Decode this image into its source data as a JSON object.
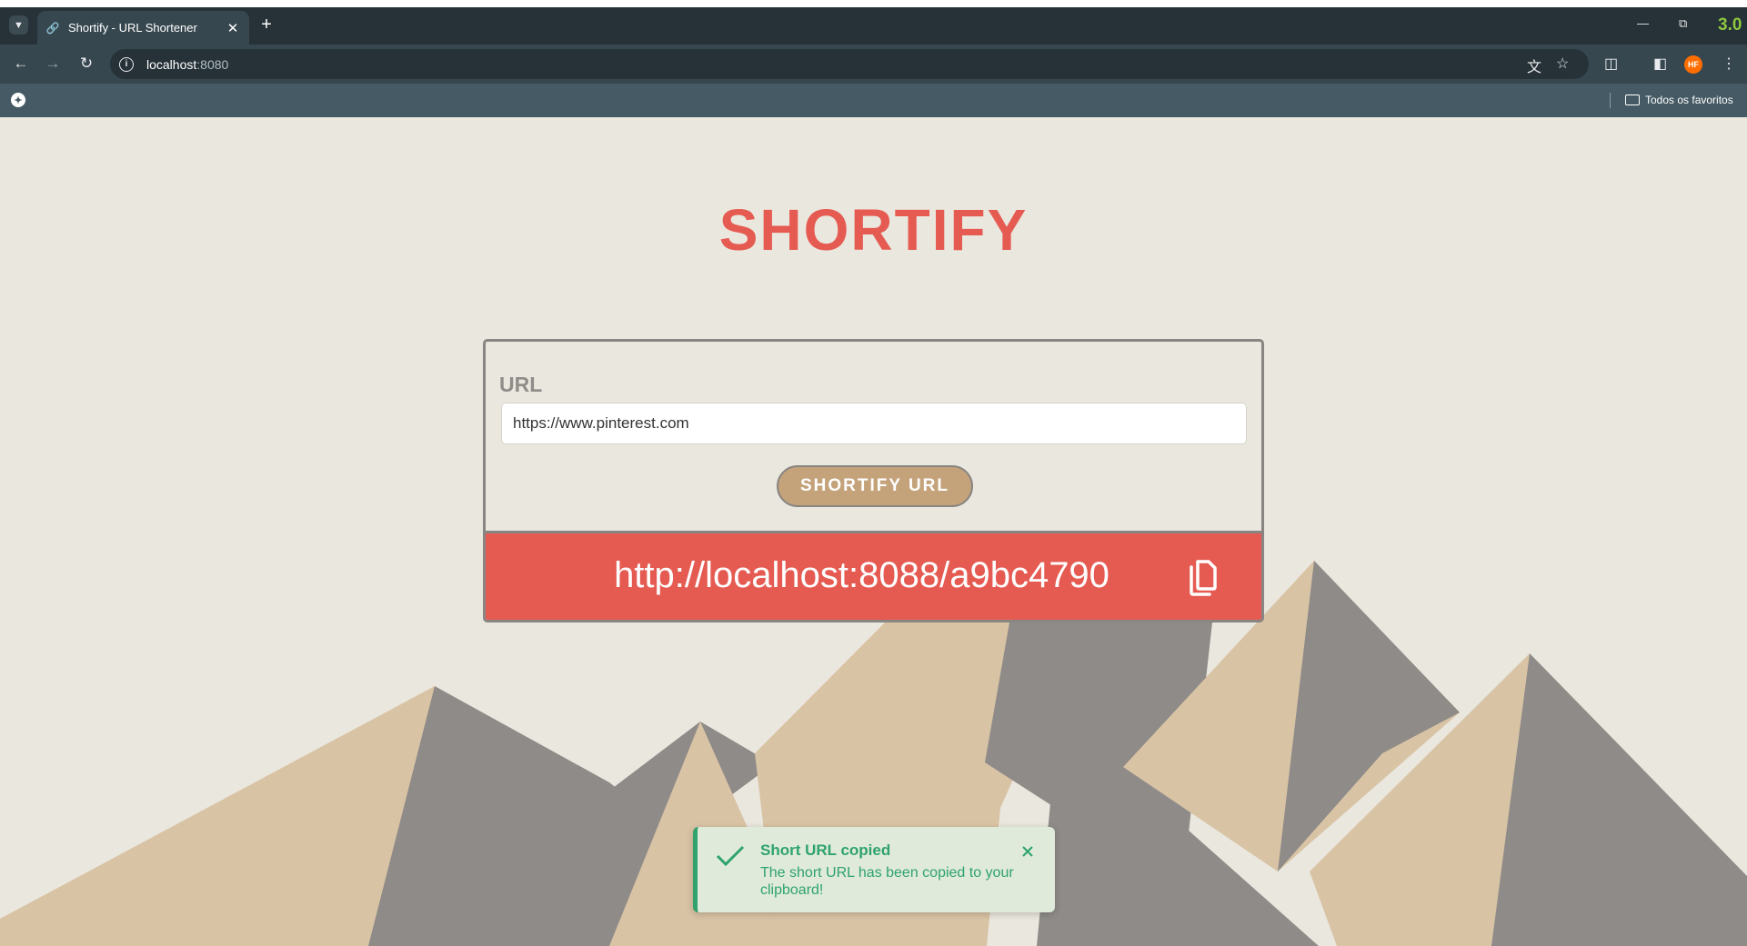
{
  "browser": {
    "tab_title": "Shortify - URL Shortener",
    "tab_close": "✕",
    "new_tab": "+",
    "url_host": "localhost",
    "url_port": ":8080",
    "bookmarks_folder": "Todos os favoritos",
    "profile_initials": "HF",
    "brand_mark": "3.0",
    "icons": {
      "tab_search": "chevron-down-icon",
      "back": "arrow-left-icon",
      "forward": "arrow-right-icon",
      "reload": "reload-icon",
      "site_info": "info-icon",
      "translate": "translate-icon",
      "bookmark": "star-icon",
      "extensions": "puzzle-icon",
      "side_panel": "side-panel-icon",
      "menu": "kebab-menu-icon"
    }
  },
  "app": {
    "title": "SHORTIFY",
    "url_label": "URL",
    "url_value": "https://www.pinterest.com",
    "button_label": "SHORTIFY URL",
    "short_url": "http://localhost:8088/a9bc4790"
  },
  "toast": {
    "title": "Short URL copied",
    "message": "The short URL has been copied to your clipboard!"
  },
  "colors": {
    "accent": "#e55b52",
    "button": "#c4a37b",
    "background": "#eae7de",
    "mountain_sand": "#d9c3a5",
    "mountain_gray": "#8e8b88",
    "toast_green": "#2fa36b"
  }
}
